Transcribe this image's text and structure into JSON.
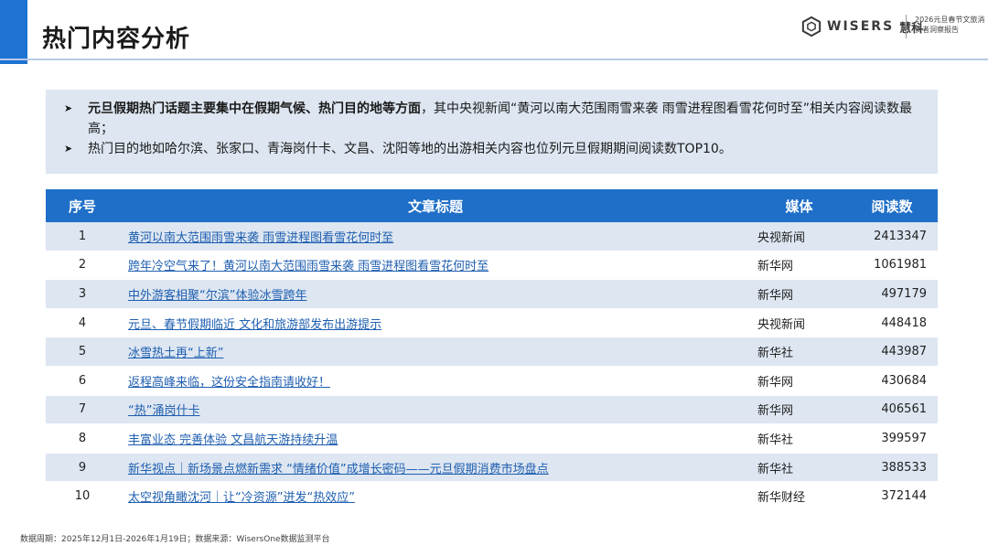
{
  "header": {
    "title": "热门内容分析",
    "logo_text": "WISERS",
    "logo_cn": "慧科",
    "report_name": "2026元旦春节文旅消费者洞察报告",
    "accent_color": "#1e73d2"
  },
  "summary": {
    "item1_bold": "元旦假期热门话题主要集中在假期气候、热门目的地等方面",
    "item1_rest": "，其中央视新闻“黄河以南大范围雨雪来袭 雨雪进程图看雪花何时至”相关内容阅读数最高；",
    "item2": "热门目的地如哈尔滨、张家口、青海岗什卡、文昌、沈阳等地的出游相关内容也位列元旦假期期间阅读数TOP10。",
    "bullet_glyph": "➤"
  },
  "table": {
    "headers": {
      "idx": "序号",
      "title": "文章标题",
      "media": "媒体",
      "reads": "阅读数"
    },
    "header_color": "#1f6fc8",
    "rows": [
      {
        "idx": "1",
        "title": "黄河以南大范围雨雪来袭 雨雪进程图看雪花何时至",
        "media": "央视新闻",
        "reads": "2413347"
      },
      {
        "idx": "2",
        "title": "跨年冷空气来了！黄河以南大范围雨雪来袭 雨雪进程图看雪花何时至",
        "media": "新华网",
        "reads": "1061981"
      },
      {
        "idx": "3",
        "title": "中外游客相聚“尔滨”体验冰雪跨年",
        "media": "新华网",
        "reads": "497179"
      },
      {
        "idx": "4",
        "title": "元旦、春节假期临近 文化和旅游部发布出游提示",
        "media": "央视新闻",
        "reads": "448418"
      },
      {
        "idx": "5",
        "title": "冰雪热土再“上新”",
        "media": "新华社",
        "reads": "443987"
      },
      {
        "idx": "6",
        "title": "返程高峰来临，这份安全指南请收好！",
        "media": "新华网",
        "reads": "430684"
      },
      {
        "idx": "7",
        "title": "“热”涌岗什卡",
        "media": "新华网",
        "reads": "406561"
      },
      {
        "idx": "8",
        "title": "丰富业态 完善体验 文昌航天游持续升温",
        "media": "新华社",
        "reads": "399597"
      },
      {
        "idx": "9",
        "title": "新华视点｜新场景点燃新需求 “情绪价值”成增长密码——元旦假期消费市场盘点",
        "media": "新华社",
        "reads": "388533"
      },
      {
        "idx": "10",
        "title": "太空视角瞰沈河｜让“冷资源”迸发“热效应”",
        "media": "新华财经",
        "reads": "372144"
      }
    ]
  },
  "footer": "数据周期：2025年12月1日-2026年1月19日；数据来源：WisersOne数据监测平台"
}
